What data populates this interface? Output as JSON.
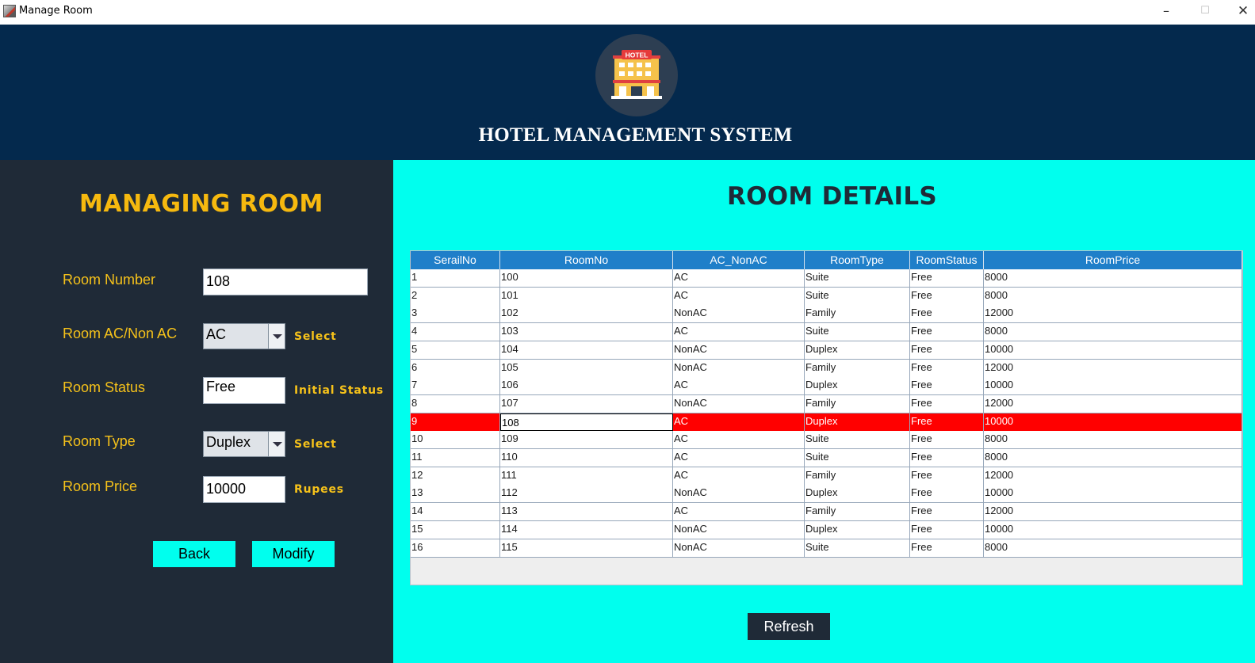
{
  "window": {
    "title": "Manage Room",
    "min_glyph": "–",
    "max_glyph": "☐",
    "close_glyph": "✕"
  },
  "header": {
    "logo_sign": "HOTEL",
    "title": "HOTEL MANAGEMENT SYSTEM"
  },
  "form": {
    "title": "MANAGING ROOM",
    "room_number_label": "Room Number",
    "room_number_value": "108",
    "ac_label": "Room AC/Non AC",
    "ac_value": "AC",
    "ac_hint": "Select",
    "status_label": "Room Status",
    "status_value": "Free",
    "status_hint": "Initial Status",
    "type_label": "Room Type",
    "type_value": "Duplex",
    "type_hint": "Select",
    "price_label": "Room Price",
    "price_value": "10000",
    "price_hint": "Rupees",
    "back_label": "Back",
    "modify_label": "Modify"
  },
  "details": {
    "title": "ROOM DETAILS",
    "refresh_label": "Refresh",
    "selected_row": 8,
    "columns": [
      "SerailNo",
      "RoomNo",
      "AC_NonAC",
      "RoomType",
      "RoomStatus",
      "RoomPrice"
    ],
    "rows": [
      [
        "1",
        "100",
        "AC",
        "Suite",
        "Free",
        "8000"
      ],
      [
        "2",
        "101",
        "AC",
        "Suite",
        "Free",
        "8000"
      ],
      [
        "3",
        "102",
        "NonAC",
        "Family",
        "Free",
        "12000"
      ],
      [
        "4",
        "103",
        "AC",
        "Suite",
        "Free",
        "8000"
      ],
      [
        "5",
        "104",
        "NonAC",
        "Duplex",
        "Free",
        "10000"
      ],
      [
        "6",
        "105",
        "NonAC",
        "Family",
        "Free",
        "12000"
      ],
      [
        "7",
        "106",
        "AC",
        "Duplex",
        "Free",
        "10000"
      ],
      [
        "8",
        "107",
        "NonAC",
        "Family",
        "Free",
        "12000"
      ],
      [
        "9",
        "108",
        "AC",
        "Duplex",
        "Free",
        "10000"
      ],
      [
        "10",
        "109",
        "AC",
        "Suite",
        "Free",
        "8000"
      ],
      [
        "11",
        "110",
        "AC",
        "Suite",
        "Free",
        "8000"
      ],
      [
        "12",
        "111",
        "AC",
        "Family",
        "Free",
        "12000"
      ],
      [
        "13",
        "112",
        "NonAC",
        "Duplex",
        "Free",
        "10000"
      ],
      [
        "14",
        "113",
        "AC",
        "Family",
        "Free",
        "12000"
      ],
      [
        "15",
        "114",
        "NonAC",
        "Duplex",
        "Free",
        "10000"
      ],
      [
        "16",
        "115",
        "NonAC",
        "Suite",
        "Free",
        "8000"
      ]
    ]
  },
  "colors": {
    "header_bg": "#04294d",
    "panel_bg": "#1f2a37",
    "accent_cyan": "#00ffee",
    "label_yellow": "#f6c21a",
    "table_header": "#1f7fc9",
    "selected_row": "#ff0000"
  }
}
